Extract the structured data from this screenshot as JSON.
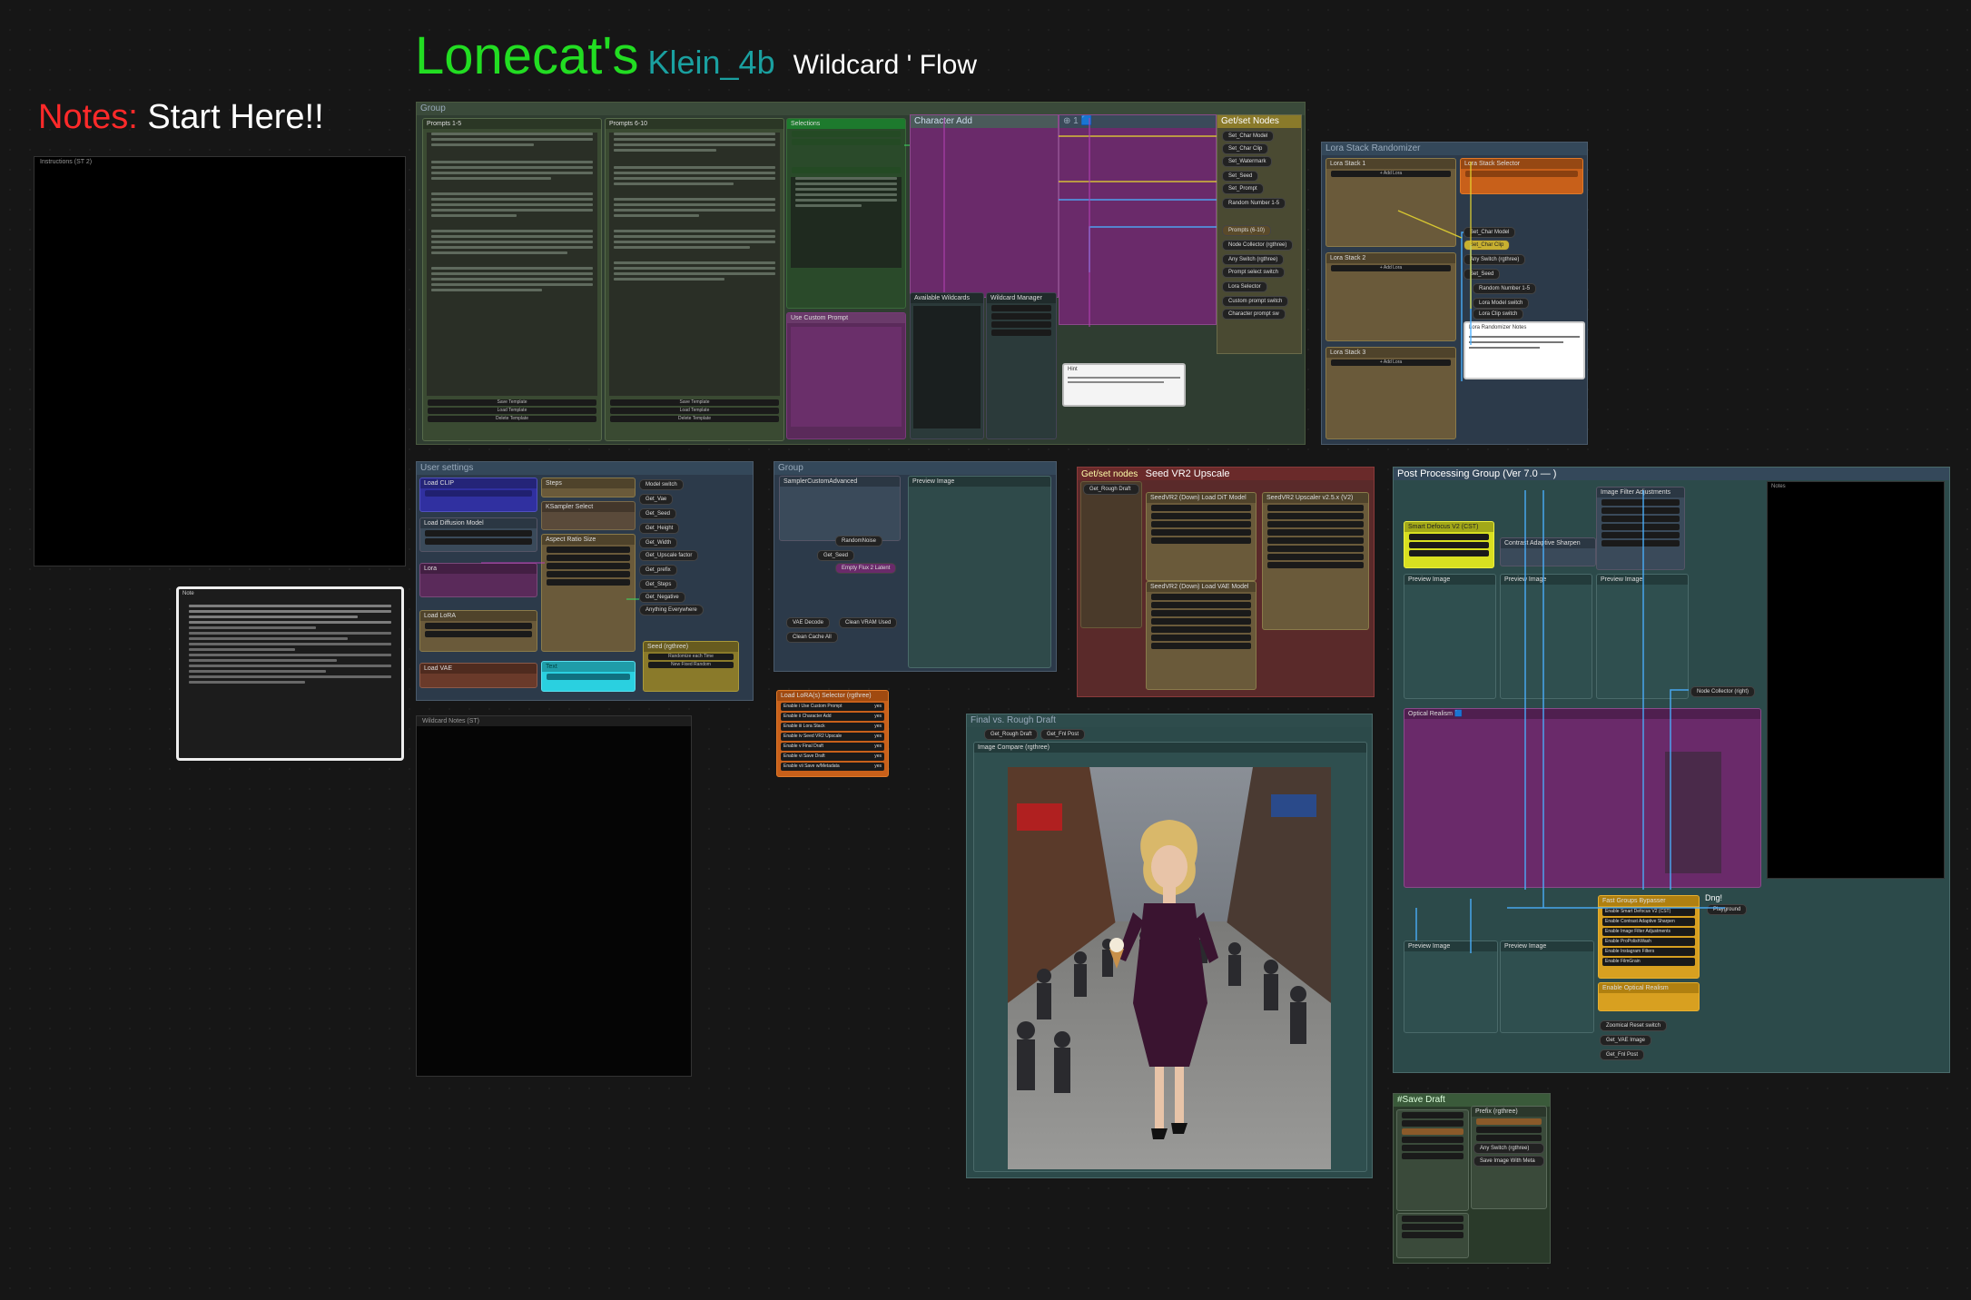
{
  "header": {
    "title": "Lonecat's",
    "subtitle": "Klein_4b",
    "flow": "Wildcard ' Flow"
  },
  "notes": {
    "label": "Notes:",
    "text": "Start Here!!",
    "instructions_title": "Instructions (ST 2)",
    "notes_node_title": "Note"
  },
  "groups": {
    "main": "Group",
    "prompts1": "Prompts 1-5",
    "prompts2": "Prompts 6-10",
    "selections": "Selections",
    "character_add": "Character Add",
    "getset": "Get/set Nodes",
    "lora_stack": "Lora Stack Randomizer",
    "user_settings": "User settings",
    "group2": "Group",
    "seed_vr2": "Seed VR2 Upscale",
    "getset2": "Get/set nodes",
    "post_processing": "Post Processing Group (Ver 7.0 — )",
    "final_rough": "Final vs. Rough Draft",
    "save_draft": "#Save Draft",
    "use_custom_prompt": "Use Custom Prompt",
    "wildcard_notes": "Wildcard Notes (ST)",
    "image_compare": "Image Compare (rgthree)",
    "load_lora": "Load LoRA(s) Selector (rgthree)"
  },
  "nodes": {
    "set_char_model": "Set_Char Model",
    "set_char_clip": "Set_Char Clip",
    "set_watermark": "Set_Watermark",
    "set_seed": "Set_Seed",
    "set_prompt": "Set_Prompt",
    "random_number": "Random Number 1-5",
    "prompts_fix": "Prompts (6-10)",
    "node_collector": "Node Collector (rgthree)",
    "any_switch": "Any Switch (rgthree)",
    "prompt_select": "Prompt select switch",
    "lora_selector": "Lora Selector",
    "custom_prompt_switch": "Custom prompt switch",
    "character_prompt": "Character prompt sw",
    "lora_stack_1": "Lora Stack 1",
    "lora_stack_2": "Lora Stack 2",
    "lora_stack_3": "Lora Stack 3",
    "add_lora": "+ Add Lora",
    "model_switch": "Model switch",
    "anything_everywhere": "Anything Everywhere",
    "random_seed": "Randomize each Time",
    "new_fixed_random": "New Fixed Random",
    "vae_decode": "VAE Decode",
    "clean_vram": "Clean VRAM Used",
    "clean_cache": "Clean Cache All",
    "get_rough_draft": "Get_Rough Draft",
    "get_final_post": "Get_Fnl Post",
    "preview_image": "Preview Image",
    "images_label": "images",
    "node_collector_2": "Node Collector (right)",
    "playground": "Playground",
    "zoomzoom": "Zoomical Reset switch",
    "get_vae_image": "Get_VAE Image",
    "get_fnl_post": "Get_Fnl Post",
    "save_image": "Save Image With Meta",
    "image_filter": "Image Filter Adjustments",
    "contrast_sharpen": "Contrast Adaptive Sharpen",
    "dng": "Dng!",
    "add_template": "Save Template",
    "load_template": "Load Template",
    "delete_template": "Delete Template"
  },
  "toggles": [
    "Enable i Use Custom Prompt",
    "Enable ii Character Add",
    "Enable iii Lora Stack",
    "Enable iv Seed VR2 Upscale",
    "Enable v Final Draft",
    "Enable vi Save Draft",
    "Enable vii Save w/Metadata"
  ],
  "toggle_states": [
    "yes",
    "yes",
    "yes",
    "yes",
    "yes",
    "yes",
    "yes"
  ],
  "pp_toggles": [
    "Enable Smart Defocus V2 (CST)",
    "Enable Contrast Adaptive Sharpen",
    "Enable Image Filter Adjustments",
    "Enable ProPolishWash",
    "Enable Instagram Filters",
    "Enable FilmGrain"
  ],
  "colors": {
    "title_green": "#22dd22",
    "subtitle_teal": "#1aa0a0",
    "notes_red": "#ff2a2a",
    "purple": "#7a2a7a",
    "orange": "#c8601a",
    "olive": "#6a6030",
    "teal_panel": "#2c4a4a"
  }
}
